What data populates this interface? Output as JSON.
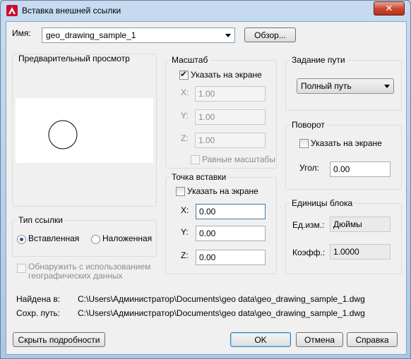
{
  "window": {
    "title": "Вставка внешней ссылки",
    "close_glyph": "✕"
  },
  "name": {
    "label": "Имя:",
    "value": "geo_drawing_sample_1",
    "browse_label": "Обзор..."
  },
  "preview": {
    "title": "Предварительный просмотр"
  },
  "scale": {
    "title": "Масштаб",
    "specify_label": "Указать на экране",
    "specify_checked": true,
    "x_label": "X:",
    "x_value": "1.00",
    "y_label": "Y:",
    "y_value": "1.00",
    "z_label": "Z:",
    "z_value": "1.00",
    "uniform_label": "Равные масштабы"
  },
  "path": {
    "title": "Задание пути",
    "value": "Полный путь"
  },
  "rotation": {
    "title": "Поворот",
    "specify_label": "Указать на экране",
    "angle_label": "Угол:",
    "angle_value": "0.00"
  },
  "insertion": {
    "title": "Точка вставки",
    "specify_label": "Указать на экране",
    "x_label": "X:",
    "x_value": "0.00",
    "y_label": "Y:",
    "y_value": "0.00",
    "z_label": "Z:",
    "z_value": "0.00"
  },
  "block_units": {
    "title": "Единицы блока",
    "unit_label": "Ед.изм.:",
    "unit_value": "Дюймы",
    "factor_label": "Коэфф.:",
    "factor_value": "1.0000"
  },
  "ref_type": {
    "title": "Тип ссылки",
    "attach_label": "Вставленная",
    "overlay_label": "Наложенная",
    "selected": "attach"
  },
  "geo": {
    "label_line1": "Обнаружить с использованием",
    "label_line2": "географических данных"
  },
  "found_in": {
    "label": "Найдена в:",
    "value": "C:\\Users\\Администратор\\Documents\\geo data\\geo_drawing_sample_1.dwg"
  },
  "saved_path": {
    "label": "Сохр. путь:",
    "value": "C:\\Users\\Администратор\\Documents\\geo data\\geo_drawing_sample_1.dwg"
  },
  "buttons": {
    "hide_details": "Скрыть подробности",
    "ok": "OK",
    "cancel": "Отмена",
    "help": "Справка"
  },
  "colors": {
    "accent": "#3c7fb1",
    "app_icon": "#c8102e",
    "close": "#c9422b"
  }
}
